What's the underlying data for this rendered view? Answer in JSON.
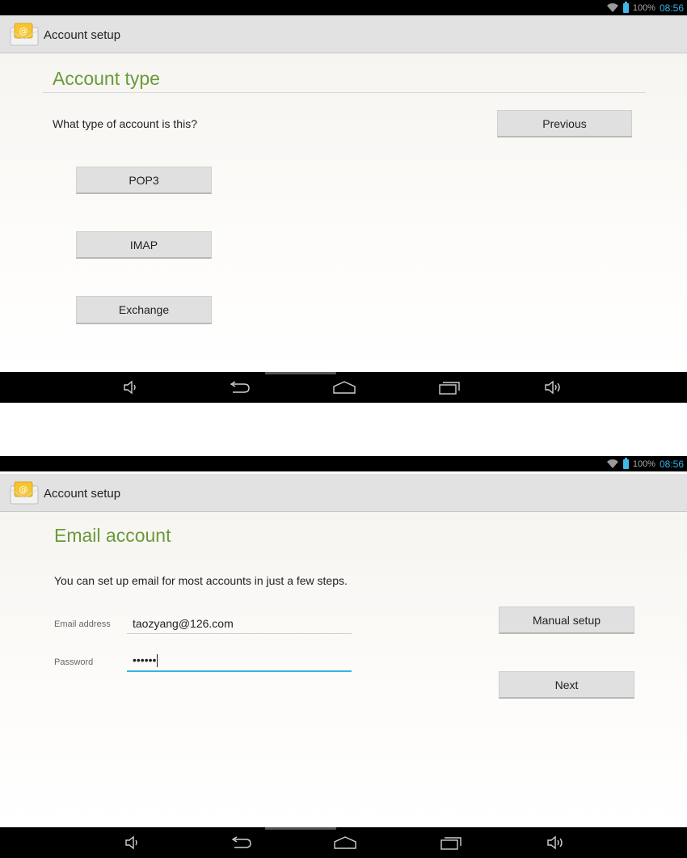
{
  "status": {
    "battery": "100%",
    "time": "08:56"
  },
  "screen1": {
    "app_title": "Account setup",
    "page_title": "Account type",
    "prompt": "What type of account is this?",
    "previous_label": "Previous",
    "options": [
      "POP3",
      "IMAP",
      "Exchange"
    ]
  },
  "screen2": {
    "app_title": "Account setup",
    "page_title": "Email account",
    "intro": "You can set up email for most accounts in just a few steps.",
    "email_label": "Email address",
    "email_value": "taozyang@126.com",
    "password_label": "Password",
    "password_value": "••••••",
    "manual_setup_label": "Manual setup",
    "next_label": "Next"
  },
  "icons": {
    "wifi": "wifi-icon",
    "battery": "battery-icon",
    "email_app": "email-app-icon",
    "volume_down": "volume-down-icon",
    "back": "back-icon",
    "home": "home-icon",
    "recents": "recent-apps-icon",
    "volume_up": "volume-up-icon"
  },
  "colors": {
    "accent_title": "#6a9a3a",
    "clock": "#33b5e5",
    "focus_line": "#33b5e5"
  }
}
